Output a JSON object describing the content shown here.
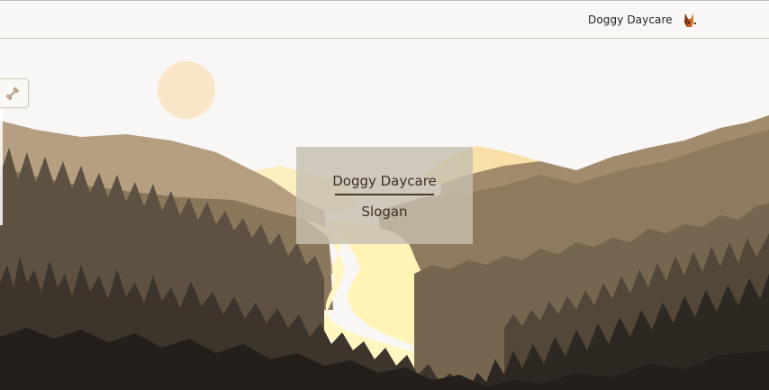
{
  "header": {
    "brand_name": "Doggy Daycare",
    "logo_icon": "dog-head-icon"
  },
  "sidebar_tab": {
    "icon": "bone-icon"
  },
  "hero": {
    "title": "Doggy Daycare",
    "slogan": "Slogan"
  },
  "colors": {
    "sky": "#f9f7f5",
    "sun": "#f9e6c8",
    "river": "#fff6c2",
    "text": "#3e3224",
    "forest_dark": "#2a251f"
  }
}
